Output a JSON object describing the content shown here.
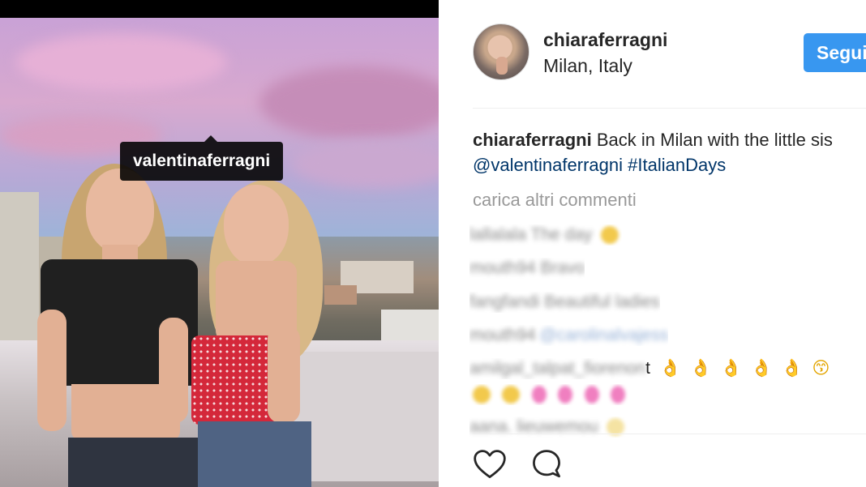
{
  "photo": {
    "tag_label": "valentinaferragni"
  },
  "post": {
    "username": "chiaraferragni",
    "location": "Milan, Italy",
    "follow_label": "Segui",
    "caption": {
      "username": "chiaraferragni",
      "text": "Back in Milan with the little sis",
      "mention": "@valentinaferragni",
      "hashtag": "#ItalianDays"
    },
    "load_more_label": "carica altri commenti",
    "comments": [
      {
        "text": "lallalala The day",
        "emoji": "smile-emoji-blurred"
      },
      {
        "text": "mouth94 Bravo"
      },
      {
        "text": "fangfandi Beautiful ladies"
      },
      {
        "text": "mouth94",
        "link": "@carolinalvajess"
      },
      {
        "text": "amilgal_talpat_fiorenon",
        "visible_char": "t",
        "emojis": [
          "👌",
          "👌",
          "👌",
          "👌",
          "👌",
          "😙"
        ]
      },
      {
        "text": "",
        "emoji_row": [
          "blur-yellow",
          "blur-yellow",
          "blur-pink",
          "blur-pink",
          "blur-pink",
          "blur-pink"
        ]
      },
      {
        "text": "aana. lieuwemou"
      }
    ],
    "actions": {
      "like_icon": "heart-icon",
      "comment_icon": "comment-bubble-icon"
    }
  },
  "colors": {
    "follow_button": "#3897f0",
    "link": "#003569",
    "muted": "#999999"
  }
}
